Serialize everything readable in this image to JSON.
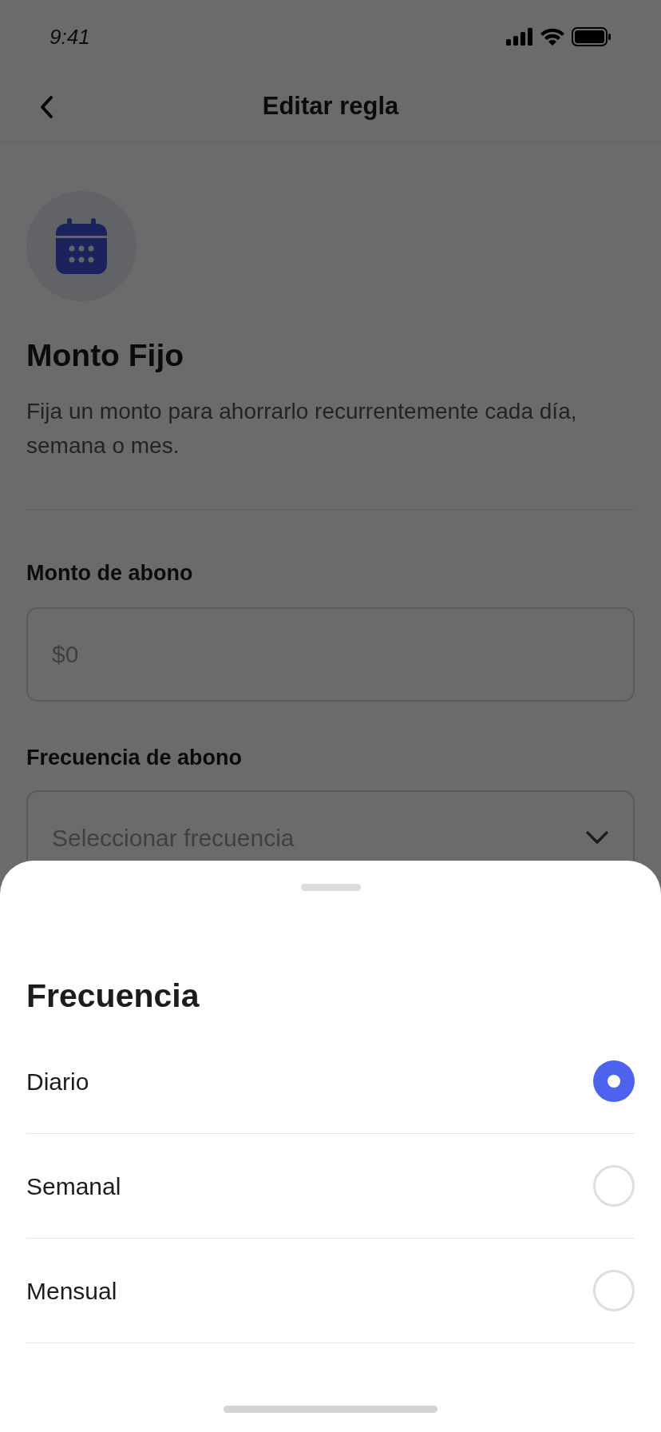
{
  "status_bar": {
    "time": "9:41"
  },
  "nav": {
    "title": "Editar regla"
  },
  "rule": {
    "title": "Monto Fijo",
    "description": "Fija un monto para ahorrarlo recurrentemente cada día, semana o mes."
  },
  "fields": [
    {
      "kind": "input",
      "label": "Monto de abono",
      "placeholder": "$0"
    },
    {
      "kind": "select",
      "label": "Frecuencia de abono",
      "placeholder": "Seleccionar frecuencia"
    }
  ],
  "sheet": {
    "title": "Frecuencia",
    "options": [
      {
        "label": "Diario",
        "selected": true
      },
      {
        "label": "Semanal",
        "selected": false
      },
      {
        "label": "Mensual",
        "selected": false
      }
    ]
  }
}
